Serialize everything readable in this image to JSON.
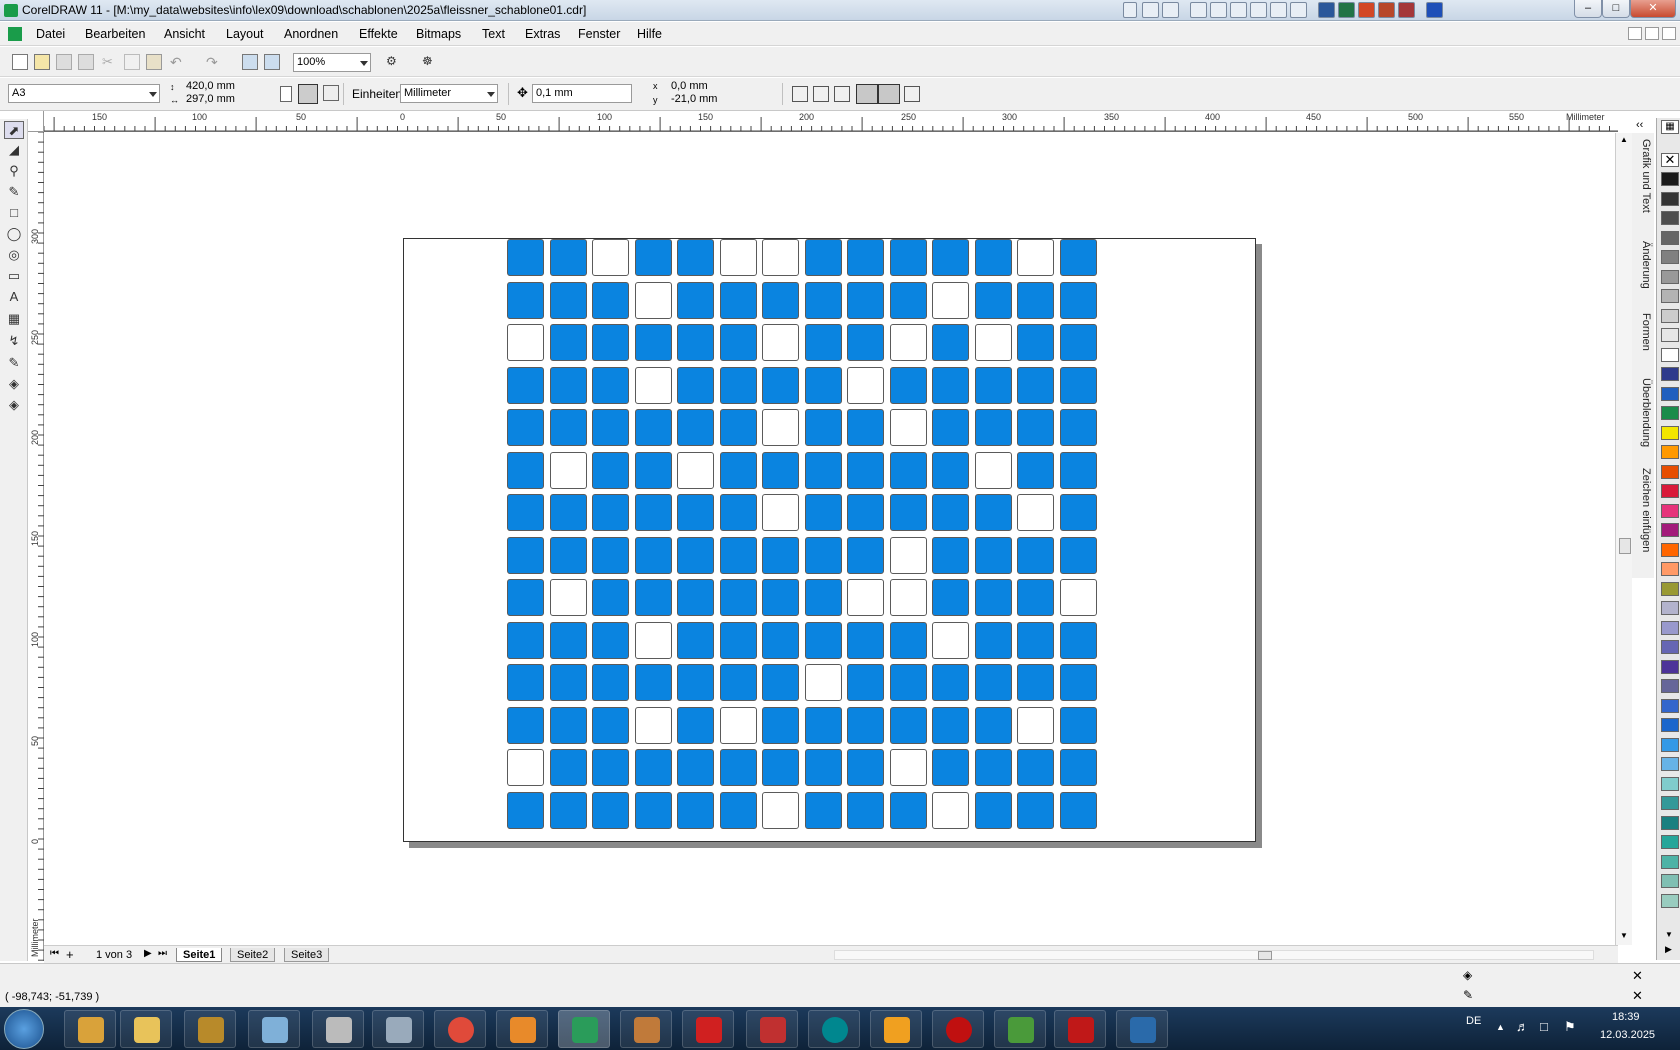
{
  "window": {
    "title": "CorelDRAW 11 - [M:\\my_data\\websites\\info\\lex09\\download\\schablonen\\2025a\\fleissner_schablone01.cdr]"
  },
  "menu": {
    "items": [
      "Datei",
      "Bearbeiten",
      "Ansicht",
      "Layout",
      "Anordnen",
      "Effekte",
      "Bitmaps",
      "Text",
      "Extras",
      "Fenster",
      "Hilfe"
    ]
  },
  "toolbar": {
    "zoom": "100%"
  },
  "property_bar": {
    "paper_size": "A3",
    "width": "420,0 mm",
    "height": "297,0 mm",
    "units_label": "Einheiten:",
    "units_value": "Millimeter",
    "nudge": "0,1 mm",
    "dup_x": "0,0 mm",
    "dup_y": "-21,0 mm"
  },
  "rulers": {
    "unit": "Millimeter",
    "h_ticks": [
      "150",
      "100",
      "50",
      "0",
      "50",
      "100",
      "150",
      "200",
      "250",
      "300",
      "350",
      "400",
      "450",
      "500",
      "550"
    ],
    "v_ticks": [
      "300",
      "250",
      "200",
      "150",
      "100",
      "50",
      "0"
    ],
    "v_unit": "Millimeter"
  },
  "dockers": {
    "tabs": [
      "Grafik und Text",
      "Änderung",
      "Formen",
      "Überblendung",
      "Zeichen einfügen"
    ]
  },
  "pages": {
    "counter": "1 von 3",
    "tabs": [
      "Seite1",
      "Seite2",
      "Seite3"
    ],
    "active": "Seite1"
  },
  "status": {
    "coordinates": "( -98,743; -51,739 )"
  },
  "taskbar": {
    "lang": "DE",
    "time": "18:39",
    "date": "12.03.2025"
  },
  "grid": {
    "fill_color": "#0a84e0",
    "empty_color": "#ffffff",
    "rows": [
      "11011001111101",
      "11101111110111",
      "01111101101011",
      "11101111011111",
      "11111101101111",
      "10110111111011",
      "11111101111101",
      "11111111101111",
      "10111111001110",
      "11101111110111",
      "11111110111111",
      "11101011111101",
      "01111111101111",
      "11111101110111"
    ]
  },
  "palette": {
    "colors": [
      "#1a1a1a",
      "#333",
      "#4d4d4d",
      "#666",
      "#808080",
      "#999",
      "#b3b3b3",
      "#ccc",
      "#e6e6e6",
      "#fff",
      "#2e3a8c",
      "#1f5fbf",
      "#1a8c4a",
      "#f2e600",
      "#ff9900",
      "#e64d00",
      "#d91a3a",
      "#e6337a",
      "#a31a7a",
      "#ff6600",
      "#ff9966",
      "#999933",
      "#b3b3cc",
      "#9999cc",
      "#6666b3",
      "#4d3399",
      "#666699",
      "#3366cc",
      "#1a66cc",
      "#3399e6",
      "#66b3e6",
      "#80cccc",
      "#339999",
      "#1a8080",
      "#26a69a",
      "#4db3a6",
      "#80bfb3",
      "#99ccbf"
    ]
  }
}
